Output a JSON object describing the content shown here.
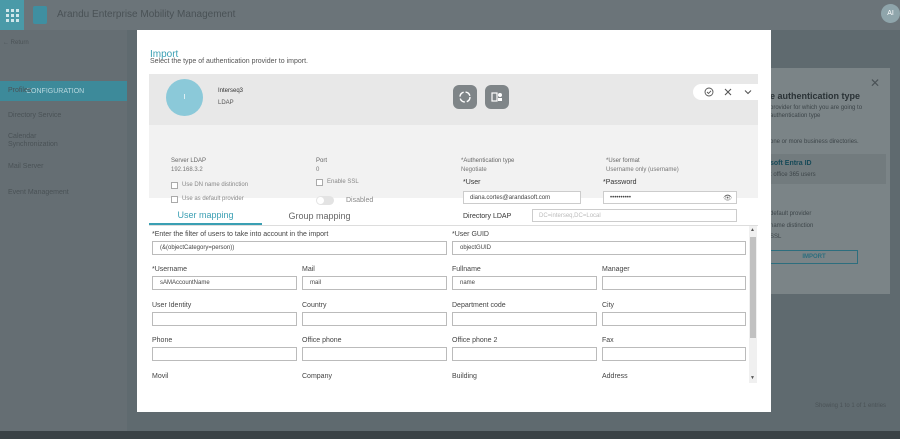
{
  "app": {
    "title": "Arandu Enterprise Mobility Management",
    "avatar": "AI"
  },
  "sidebar": {
    "back": "← Return",
    "config": "CONFIGURATION",
    "items": [
      "Profiles",
      "Directory Service",
      "Calendar\nSynchronization",
      "Mail Server",
      "Event Management"
    ]
  },
  "right_panel": {
    "title": "e authentication type",
    "text1": "provider for which you are going to",
    "text2": "authentication type",
    "text3": "one or more business directories.",
    "link": "soft Entra ID",
    "link_sub": "t office 365 users",
    "opt1": "default provider",
    "opt2": "name distinction",
    "opt3": "SSL",
    "import": "IMPORT",
    "footer": "Showing 1 to 1 of 1 entries"
  },
  "modal": {
    "title": "Import",
    "subtitle": "Select the type of authentication provider to import.",
    "provider": {
      "initial": "I",
      "name": "Interseq3",
      "type": "LDAP",
      "server_label": "Server LDAP",
      "server_value": "192.168.3.2",
      "port_label": "Port",
      "port_value": "0",
      "auth_label": "*Authentication type",
      "auth_value": "Negotiate",
      "uformat_label": "*User format",
      "uformat_value": "Username only (username)",
      "chk_dn": "Use DN name distinction",
      "chk_default": "Use as default provider",
      "chk_ssl": "Enable SSL",
      "disabled": "Disabled",
      "user_label": "*User",
      "user_value": "diana.cortes@arandasoft.com",
      "password_label": "*Password",
      "password_value": "••••••••••",
      "dir_label": "Directory LDAP",
      "dir_placeholder": "DC=interseq,DC=Local"
    },
    "tabs": [
      "User mapping",
      "Group mapping"
    ],
    "fields": [
      {
        "label": "*Enter the filter of users to take into account in the import",
        "value": "(&(objectCategory=person))"
      },
      {
        "label": "*User GUID",
        "value": "objectGUID"
      },
      {
        "label": "*Username",
        "value": "sAMAccountName"
      },
      {
        "label": "Mail",
        "value": "mail"
      },
      {
        "label": "Fullname",
        "value": "name"
      },
      {
        "label": "Manager",
        "value": ""
      },
      {
        "label": "User Identity",
        "value": ""
      },
      {
        "label": "Country",
        "value": ""
      },
      {
        "label": "Department code",
        "value": ""
      },
      {
        "label": "City",
        "value": ""
      },
      {
        "label": "Phone",
        "value": ""
      },
      {
        "label": "Office phone",
        "value": ""
      },
      {
        "label": "Office phone 2",
        "value": ""
      },
      {
        "label": "Fax",
        "value": ""
      },
      {
        "label": "Movil",
        "value": ""
      },
      {
        "label": "Company",
        "value": ""
      },
      {
        "label": "Building",
        "value": ""
      },
      {
        "label": "Address",
        "value": ""
      }
    ]
  },
  "colors": {
    "accent": "#3a9fb3",
    "overlay": "#5f6a6f"
  }
}
